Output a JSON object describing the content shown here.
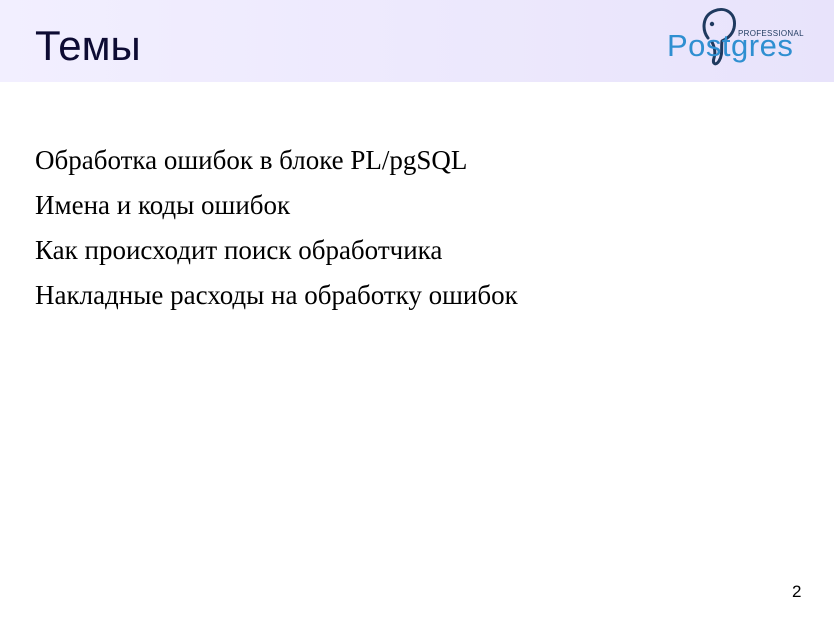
{
  "slide": {
    "title": "Темы",
    "page_number": "2",
    "header_colors": {
      "start": "#f2efff",
      "end": "#e8e3fb"
    }
  },
  "logo": {
    "small_text": "PROFESSIONAL",
    "word": "Postgres",
    "icon": "elephant-icon",
    "color": "#2f8fd1"
  },
  "topics": [
    "Обработка ошибок в блоке PL/pgSQL",
    "Имена и коды ошибок",
    "Как происходит поиск обработчика",
    "Накладные расходы на обработку ошибок"
  ]
}
